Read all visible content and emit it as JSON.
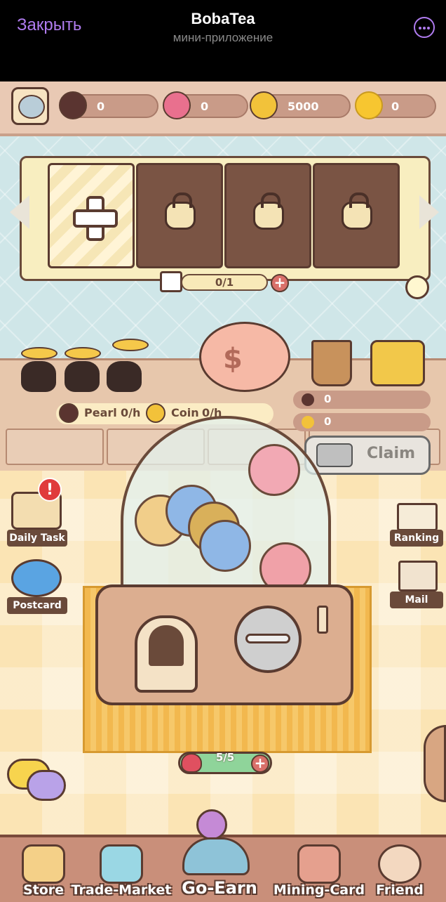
{
  "telegram_bar": {
    "close_label": "Закрыть",
    "title": "BobaTea",
    "subtitle": "мини-приложение"
  },
  "currencies": [
    {
      "icon": "pearl-icon",
      "value": "0",
      "color": "#5a3430"
    },
    {
      "icon": "lollipop-icon",
      "value": "0",
      "color": "#e9708e"
    },
    {
      "icon": "coin-icon",
      "value": "5000",
      "color": "#f2c23a"
    },
    {
      "icon": "sparkle-coin-icon",
      "value": "0",
      "color": "#f7c630"
    }
  ],
  "card_slots": {
    "progress": "0/1",
    "slots": [
      "add",
      "locked",
      "locked",
      "locked"
    ]
  },
  "production": {
    "pearl_label": "Pearl",
    "pearl_rate": "0/h",
    "coin_label": "Coin",
    "coin_rate": "0/h",
    "pearl_stock": "0",
    "coin_stock": "0",
    "claim_label": "Claim"
  },
  "side_buttons": {
    "daily_task": "Daily Task",
    "postcard": "Postcard",
    "ranking": "Ranking",
    "mail": "Mail"
  },
  "gacha": {
    "energy": "5/5",
    "ball_colors": [
      "#f2a9b4",
      "#f1ce8a",
      "#8fb7e6",
      "#d9b05a",
      "#8fb7e6",
      "#f0a1a8"
    ]
  },
  "nav": [
    {
      "label": "Store",
      "icon": "store-icon"
    },
    {
      "label": "Trade-Market",
      "icon": "trade-market-icon"
    },
    {
      "label": "Go-Earn",
      "icon": "go-earn-joystick-icon"
    },
    {
      "label": "Mining-Card",
      "icon": "mining-card-icon"
    },
    {
      "label": "Friend",
      "icon": "friend-icon"
    }
  ]
}
